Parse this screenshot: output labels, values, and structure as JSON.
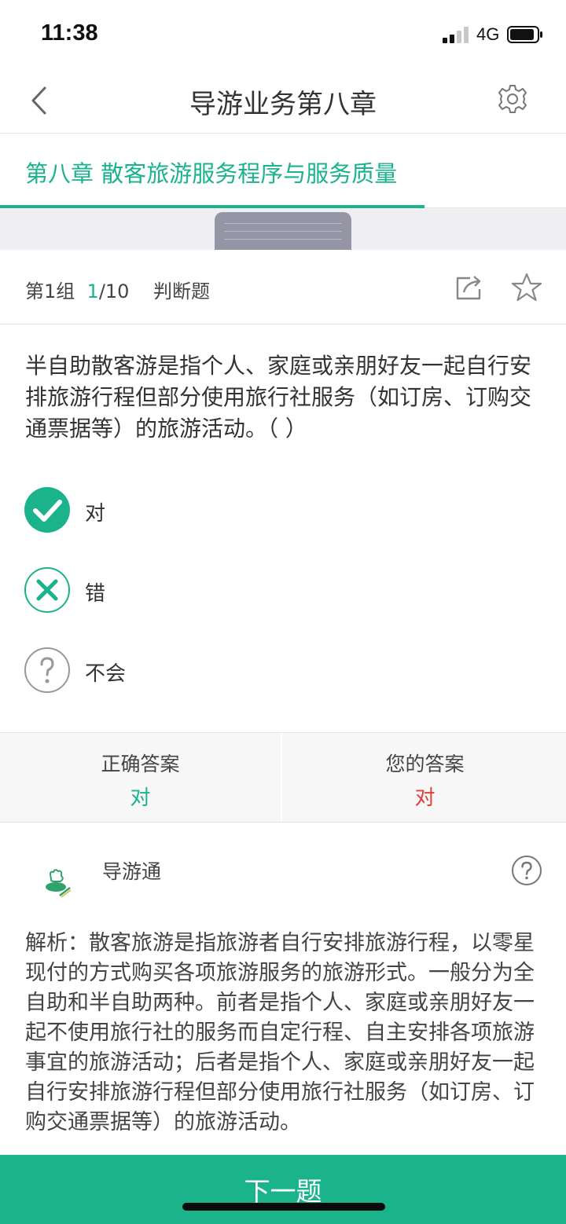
{
  "status_bar": {
    "time": "11:38",
    "network": "4G"
  },
  "nav": {
    "title": "导游业务第八章",
    "back_icon": "chevron-left-icon",
    "settings_icon": "gear-icon"
  },
  "chapter_tab": {
    "label": "第八章 散客旅游服务程序与服务质量"
  },
  "question_header": {
    "group": "第1组",
    "current": "1",
    "total": "/10",
    "type": "判断题",
    "share_icon": "share-icon",
    "star_icon": "star-icon"
  },
  "question": {
    "text": "半自助散客游是指个人、家庭或亲朋好友一起自行安排旅游行程但部分使用旅行社服务（如订房、订购交通票据等）的旅游活动。（    ）"
  },
  "options": [
    {
      "label": "对",
      "icon": "check-circle-icon",
      "selected": true
    },
    {
      "label": "错",
      "icon": "x-circle-icon",
      "selected": false
    },
    {
      "label": "不会",
      "icon": "question-circle-icon",
      "selected": false
    }
  ],
  "answers": {
    "correct_label": "正确答案",
    "correct_value": "对",
    "yours_label": "您的答案",
    "yours_value": "对"
  },
  "explanation": {
    "app_name": "导游通",
    "text": "解析：散客旅游是指旅游者自行安排旅游行程，以零星现付的方式购买各项旅游服务的旅游形式。一般分为全自助和半自助两种。前者是指个人、家庭或亲朋好友一起不使用旅行社的服务而自定行程、自主安排各项旅游事宜的旅游活动；后者是指个人、家庭或亲朋好友一起自行安排旅游行程但部分使用旅行社服务（如订房、订购交通票据等）的旅游活动。"
  },
  "footer": {
    "next_label": "下一题"
  },
  "colors": {
    "accent": "#1ab38c",
    "wrong": "#e0403a",
    "gray_icon": "#999999"
  }
}
